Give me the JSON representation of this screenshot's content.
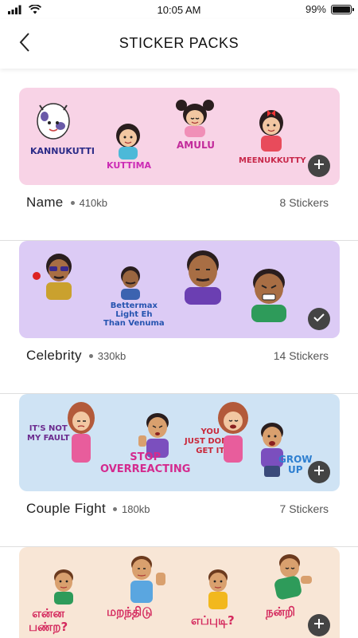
{
  "status_bar": {
    "time": "10:05 AM",
    "battery": "99%",
    "battery_level": 0.99
  },
  "header": {
    "title": "STICKER PACKS"
  },
  "packs": [
    {
      "name": "Name",
      "size": "410kb",
      "count": "8 Stickers",
      "action": "add-icon",
      "background": "#f8d3e6",
      "stickers": [
        "KANNUKUTTI",
        "KUTTIMA",
        "AMULU",
        "MEENUKKUTTY"
      ]
    },
    {
      "name": "Celebrity",
      "size": "330kb",
      "count": "14 Stickers",
      "action": "check-icon",
      "background": "#dccbf5",
      "stickers": [
        "Bettermax",
        "Light Eh",
        "Than Venuma"
      ]
    },
    {
      "name": "Couple Fight",
      "size": "180kb",
      "count": "7 Stickers",
      "action": "add-icon",
      "background": "#cfe3f4",
      "stickers": [
        "IT'S NOT",
        "MY FAULT",
        "STOP",
        "OVERREACTING",
        "YOU",
        "JUST DON'T",
        "GET IT",
        "GROW",
        "UP"
      ]
    },
    {
      "name": "",
      "size": "",
      "count": "",
      "action": "add-icon",
      "background": "#f8e6d6",
      "stickers": [
        "என்ன",
        "பண்ற?",
        "மறந்திடு",
        "எப்புடி?",
        "நன்றி"
      ]
    }
  ]
}
